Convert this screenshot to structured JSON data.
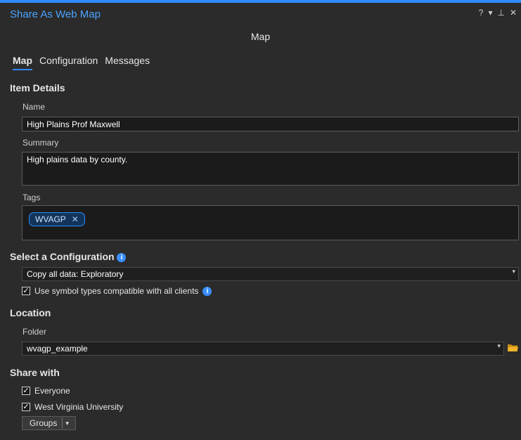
{
  "window": {
    "title": "Share As Web Map",
    "controls": {
      "help": "?",
      "menu": "▾",
      "pin": "⊥",
      "close": "✕"
    }
  },
  "header": {
    "subtitle": "Map"
  },
  "tabs": [
    {
      "label": "Map",
      "active": true
    },
    {
      "label": "Configuration",
      "active": false
    },
    {
      "label": "Messages",
      "active": false
    }
  ],
  "item_details": {
    "heading": "Item Details",
    "name_label": "Name",
    "name_value": "High Plains Prof Maxwell",
    "summary_label": "Summary",
    "summary_value": "High plains data by county.",
    "tags_label": "Tags",
    "tags": [
      {
        "label": "WVAGP",
        "remove": "✕"
      }
    ]
  },
  "configuration": {
    "heading": "Select a Configuration",
    "info_icon": "i",
    "selected": "Copy all data: Exploratory",
    "symbol_option": {
      "label": "Use symbol types compatible with all clients",
      "checked": true,
      "check": "✓"
    }
  },
  "location": {
    "heading": "Location",
    "folder_label": "Folder",
    "folder_value": "wvagp_example"
  },
  "share_with": {
    "heading": "Share with",
    "options": [
      {
        "label": "Everyone",
        "checked": true,
        "check": "✓"
      },
      {
        "label": "West Virginia University",
        "checked": true,
        "check": "✓"
      }
    ],
    "groups_label": "Groups",
    "dropdown_caret": "▾"
  },
  "colors": {
    "accent": "#2e8bff",
    "background": "#2b2b2b",
    "field_background": "#1b1b1b",
    "folder": "#e8a317"
  }
}
